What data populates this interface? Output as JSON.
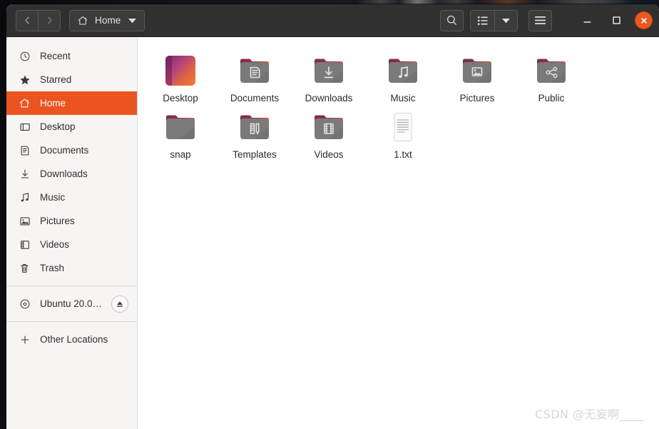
{
  "window": {
    "title": "Home",
    "nav": {
      "back_label": "Back",
      "forward_label": "Forward"
    },
    "pathbar": {
      "icon": "home-icon",
      "label": "Home",
      "dropdown_icon": "chevron-down-icon"
    },
    "toolbar": {
      "search_label": "Search",
      "view_list_label": "List view",
      "view_caret_label": "View options",
      "menu_label": "Main menu"
    },
    "controls": {
      "minimize_label": "Minimize",
      "maximize_label": "Maximize",
      "close_label": "Close"
    },
    "accent_color": "#e95420",
    "headerbar_color": "#303030",
    "close_button_color": "#e8581f"
  },
  "sidebar": {
    "items": [
      {
        "label": "Recent",
        "icon": "clock-icon",
        "active": false
      },
      {
        "label": "Starred",
        "icon": "star-icon",
        "active": false
      },
      {
        "label": "Home",
        "icon": "home-icon",
        "active": true
      },
      {
        "label": "Desktop",
        "icon": "desktop-icon",
        "active": false
      },
      {
        "label": "Documents",
        "icon": "document-icon",
        "active": false
      },
      {
        "label": "Downloads",
        "icon": "download-icon",
        "active": false
      },
      {
        "label": "Music",
        "icon": "music-icon",
        "active": false
      },
      {
        "label": "Pictures",
        "icon": "picture-icon",
        "active": false
      },
      {
        "label": "Videos",
        "icon": "video-icon",
        "active": false
      },
      {
        "label": "Trash",
        "icon": "trash-icon",
        "active": false
      }
    ],
    "devices": [
      {
        "label": "Ubuntu 20.0…",
        "icon": "disc-icon",
        "eject_icon": "eject-icon"
      }
    ],
    "other": {
      "label": "Other Locations",
      "icon": "plus-icon"
    }
  },
  "files": [
    {
      "name": "Desktop",
      "type": "desktop-folder",
      "icon": "desktop-gradient-icon"
    },
    {
      "name": "Documents",
      "type": "folder",
      "icon": "folder-documents-icon"
    },
    {
      "name": "Downloads",
      "type": "folder",
      "icon": "folder-downloads-icon"
    },
    {
      "name": "Music",
      "type": "folder",
      "icon": "folder-music-icon"
    },
    {
      "name": "Pictures",
      "type": "folder",
      "icon": "folder-pictures-icon"
    },
    {
      "name": "Public",
      "type": "folder",
      "icon": "folder-public-icon"
    },
    {
      "name": "snap",
      "type": "folder",
      "icon": "folder-icon"
    },
    {
      "name": "Templates",
      "type": "folder",
      "icon": "folder-templates-icon"
    },
    {
      "name": "Videos",
      "type": "folder",
      "icon": "folder-videos-icon"
    },
    {
      "name": "1.txt",
      "type": "text-file",
      "icon": "text-file-icon"
    }
  ],
  "watermark": {
    "text": "CSDN @无妄啊____"
  }
}
